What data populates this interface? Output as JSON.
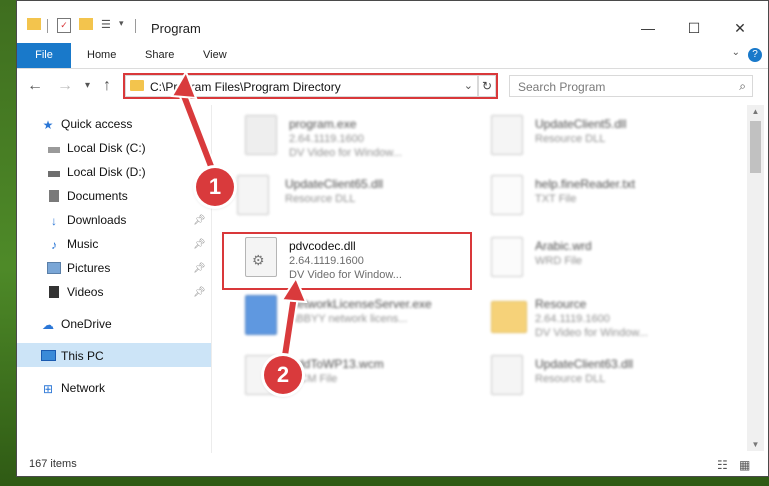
{
  "window": {
    "title": "Program"
  },
  "ribbon": {
    "tabs": [
      "File",
      "Home",
      "Share",
      "View"
    ]
  },
  "nav": {
    "address": "C:\\Program Files\\Program Directory",
    "search_placeholder": "Search Program"
  },
  "sidebar": {
    "items": [
      {
        "label": "Quick access",
        "icon": "star-icon"
      },
      {
        "label": "Local Disk (C:)",
        "icon": "drive-icon"
      },
      {
        "label": "Local Disk (D:)",
        "icon": "drive-icon"
      },
      {
        "label": "Documents",
        "icon": "documents-icon"
      },
      {
        "label": "Downloads",
        "icon": "download-icon"
      },
      {
        "label": "Music",
        "icon": "music-icon"
      },
      {
        "label": "Pictures",
        "icon": "pictures-icon"
      },
      {
        "label": "Videos",
        "icon": "videos-icon"
      },
      {
        "label": "OneDrive",
        "icon": "cloud-icon"
      },
      {
        "label": "This PC",
        "icon": "pc-icon"
      },
      {
        "label": "Network",
        "icon": "network-icon"
      }
    ],
    "selected": "This PC"
  },
  "files": [
    {
      "name": "program.exe",
      "line2": "2.64.1119.1600",
      "line3": "DV Video for Window..."
    },
    {
      "name": "UpdateClient5.dll",
      "line2": "Resource DLL",
      "line3": ""
    },
    {
      "name": "UpdateClient65.dll",
      "line2": "Resource DLL",
      "line3": ""
    },
    {
      "name": "help.fineReader.txt",
      "line2": "TXT File",
      "line3": ""
    },
    {
      "name": "pdvcodec.dll",
      "line2": "2.64.1119.1600",
      "line3": "DV Video for Window..."
    },
    {
      "name": "Arabic.wrd",
      "line2": "WRD File",
      "line3": ""
    },
    {
      "name": "NetworkLicenseServer.exe",
      "line2": "ABBYY network licens...",
      "line3": ""
    },
    {
      "name": "Resource",
      "line2": "2.64.1119.1600",
      "line3": "DV Video for Window..."
    },
    {
      "name": "AddToWP13.wcm",
      "line2": "WCM File",
      "line3": ""
    },
    {
      "name": "UpdateClient63.dll",
      "line2": "Resource DLL",
      "line3": ""
    }
  ],
  "status": {
    "count": "167 items"
  },
  "callouts": [
    "1",
    "2"
  ],
  "colors": {
    "accent": "#1979ca",
    "highlight": "#d9383a",
    "selected": "#cce4f7"
  }
}
